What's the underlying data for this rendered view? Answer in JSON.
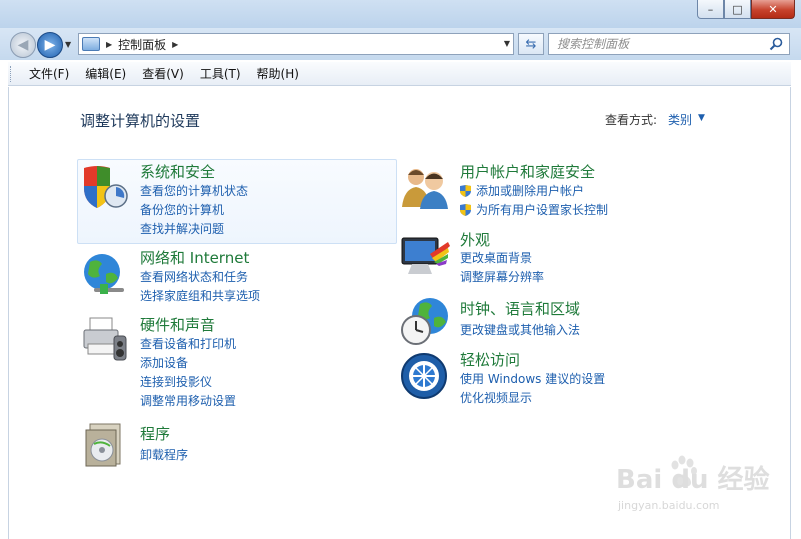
{
  "window": {
    "minimize": "–",
    "maximize": "□",
    "close": "✕"
  },
  "address": {
    "path": "控制面板"
  },
  "search": {
    "placeholder": "搜索控制面板"
  },
  "menu": [
    "文件(F)",
    "编辑(E)",
    "查看(V)",
    "工具(T)",
    "帮助(H)"
  ],
  "page": {
    "title": "调整计算机的设置",
    "view_by_label": "查看方式:",
    "view_by_value": "类别"
  },
  "categories": [
    {
      "title": "系统和安全",
      "icon": "shield-icon",
      "links": [
        "查看您的计算机状态",
        "备份您的计算机",
        "查找并解决问题"
      ]
    },
    {
      "title": "网络和 Internet",
      "icon": "network-globe-icon",
      "links": [
        "查看网络状态和任务",
        "选择家庭组和共享选项"
      ]
    },
    {
      "title": "硬件和声音",
      "icon": "printer-icon",
      "links": [
        "查看设备和打印机",
        "添加设备",
        "连接到投影仪",
        "调整常用移动设置"
      ]
    },
    {
      "title": "程序",
      "icon": "programs-icon",
      "links": [
        "卸载程序"
      ]
    },
    {
      "title": "用户帐户和家庭安全",
      "icon": "users-icon",
      "links": [
        "添加或删除用户帐户",
        "为所有用户设置家长控制"
      ]
    },
    {
      "title": "外观",
      "icon": "monitor-palette-icon",
      "links": [
        "更改桌面背景",
        "调整屏幕分辨率"
      ]
    },
    {
      "title": "时钟、语言和区域",
      "icon": "clock-globe-icon",
      "links": [
        "更改键盘或其他输入法"
      ]
    },
    {
      "title": "轻松访问",
      "icon": "ease-of-access-icon",
      "links": [
        "使用 Windows 建议的设置",
        "优化视频显示"
      ]
    }
  ],
  "watermark": {
    "brand": "Bai du 经验",
    "url": "jingyan.baidu.com"
  },
  "colors": {
    "category_title": "#1f7a3a",
    "link": "#1e5fae",
    "page_title": "#1e395b"
  }
}
